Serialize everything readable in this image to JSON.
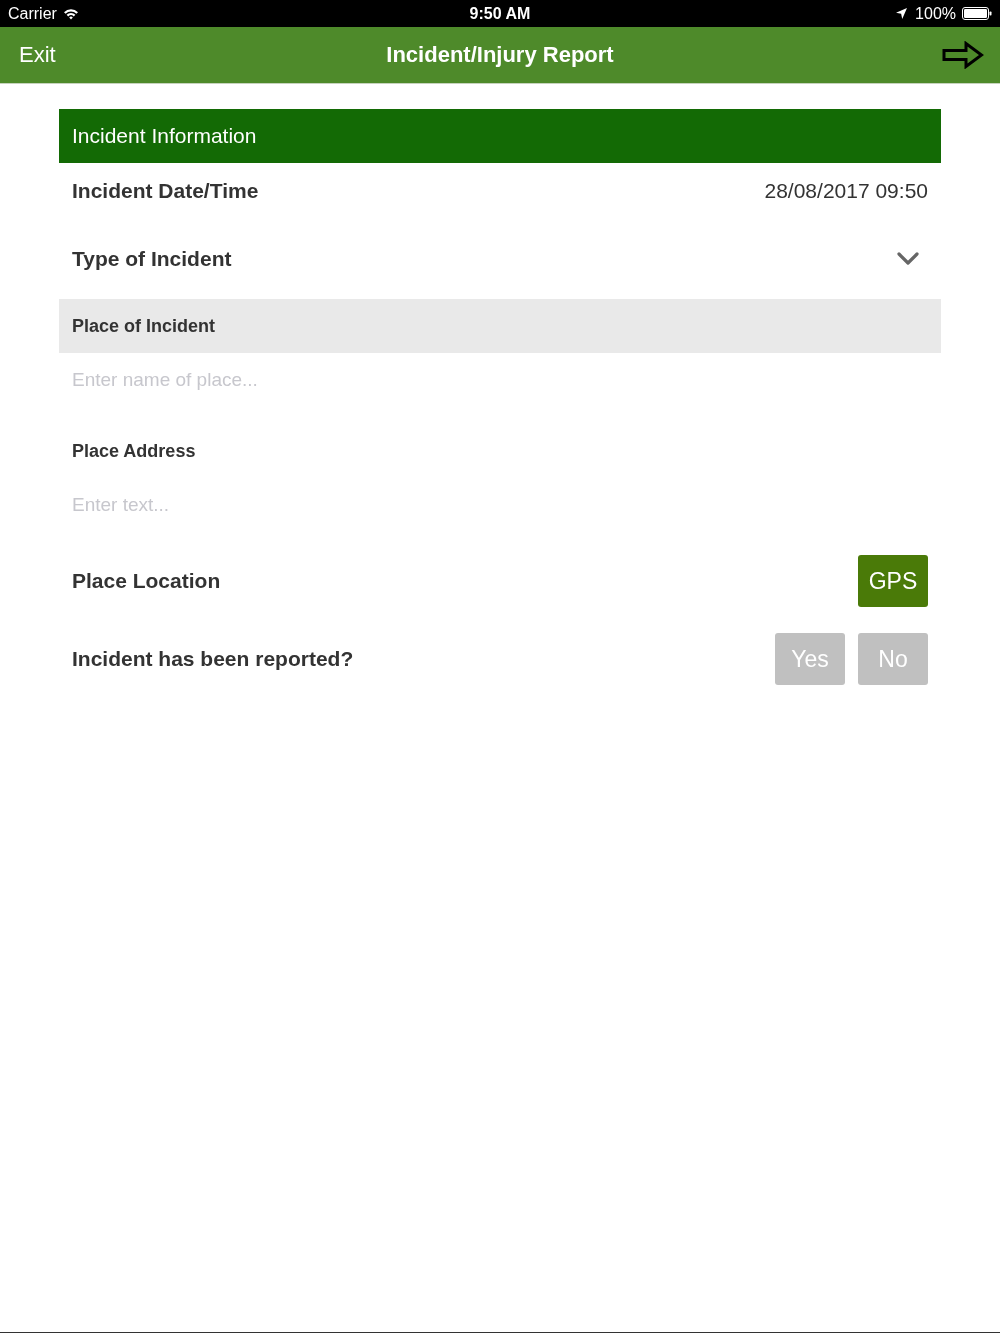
{
  "status_bar": {
    "carrier": "Carrier",
    "time": "9:50 AM",
    "battery": "100%"
  },
  "nav_bar": {
    "exit": "Exit",
    "title": "Incident/Injury Report"
  },
  "section": {
    "title": "Incident Information"
  },
  "rows": [
    {
      "kind": "value",
      "label": "Incident Date/Time",
      "value": "28/08/2017 09:50"
    },
    {
      "kind": "dropdown",
      "label": "Type of Incident"
    },
    {
      "kind": "header",
      "label": "Place of Incident"
    },
    {
      "kind": "input",
      "placeholder": "Enter name of place..."
    },
    {
      "kind": "subheader",
      "label": "Place Address"
    },
    {
      "kind": "input",
      "placeholder": "Enter text..."
    },
    {
      "kind": "action",
      "label": "Place Location",
      "button": "GPS"
    },
    {
      "kind": "choice",
      "label": "Incident has been reported?",
      "options": [
        {
          "label": "Yes",
          "selected": false
        },
        {
          "label": "No",
          "selected": false
        }
      ]
    }
  ]
}
